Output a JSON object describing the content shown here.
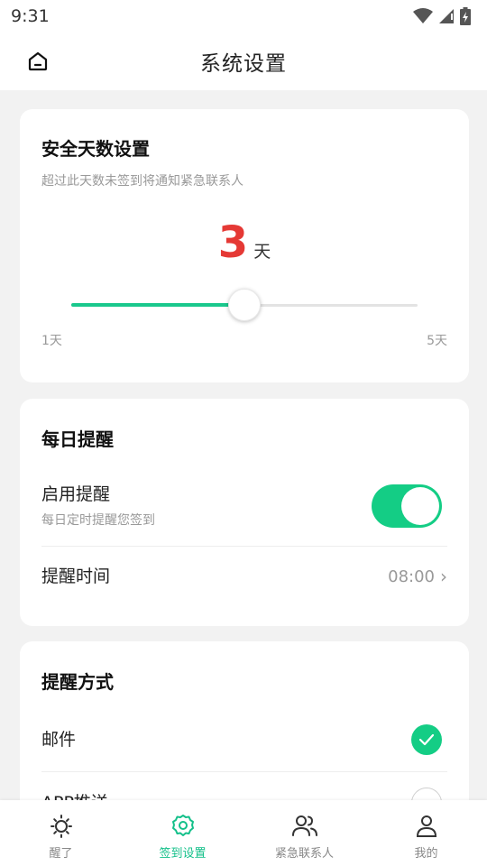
{
  "status_bar": {
    "time": "9:31"
  },
  "header": {
    "title": "系统设置",
    "home_icon": "home-icon"
  },
  "safe_days": {
    "title": "安全天数设置",
    "subtitle": "超过此天数未签到将通知紧急联系人",
    "value": "3",
    "unit": "天",
    "slider": {
      "min": 1,
      "max": 5,
      "value": 3,
      "min_label": "1天",
      "max_label": "5天"
    }
  },
  "daily_reminder": {
    "title": "每日提醒",
    "enable_label": "启用提醒",
    "enable_sub": "每日定时提醒您签到",
    "enabled": true,
    "time_label": "提醒时间",
    "time_value": "08:00",
    "chevron": "›"
  },
  "reminder_method": {
    "title": "提醒方式",
    "options": [
      {
        "label": "邮件",
        "checked": true
      },
      {
        "label": "APP推送",
        "checked": false
      }
    ]
  },
  "tabbar": {
    "tabs": [
      {
        "label": "醒了",
        "icon": "sun-icon",
        "active": false
      },
      {
        "label": "签到设置",
        "icon": "gear-icon",
        "active": true
      },
      {
        "label": "紧急联系人",
        "icon": "contacts-icon",
        "active": false
      },
      {
        "label": "我的",
        "icon": "person-icon",
        "active": false
      }
    ]
  },
  "colors": {
    "accent": "#14cd85",
    "days_number": "#e53935",
    "active_tab": "#14c08a"
  }
}
